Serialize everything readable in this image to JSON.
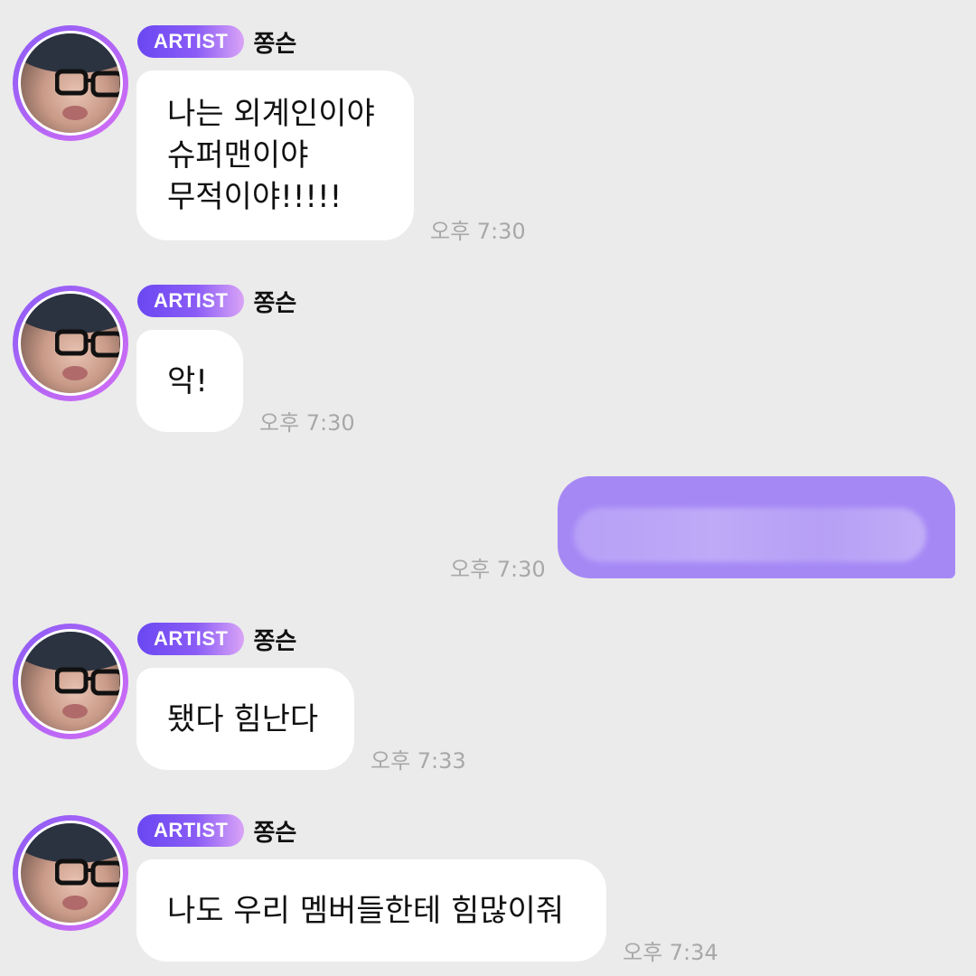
{
  "sender": {
    "badge": "ARTIST",
    "name": "쫑슨"
  },
  "messages": [
    {
      "lines": [
        "나는 외계인이야",
        "슈퍼맨이야",
        "무적이야!!!!!"
      ],
      "time": "오후 7:30"
    },
    {
      "lines": [
        "악!"
      ],
      "time": "오후 7:30"
    },
    {
      "outgoing": true,
      "content_hidden": true,
      "time": "오후 7:30"
    },
    {
      "lines": [
        "됐다 힘난다"
      ],
      "time": "오후 7:33"
    },
    {
      "lines": [
        "나도 우리 멤버들한테 힘많이줘"
      ],
      "time": "오후 7:34"
    }
  ],
  "colors": {
    "background": "#ebebeb",
    "incoming_bubble": "#ffffff",
    "outgoing_bubble": "#a688f5",
    "badge_start": "#6a47f2",
    "badge_end": "#d9a4f7",
    "avatar_ring": "#8a5cf6",
    "timestamp": "#a8a8a8"
  },
  "icons": {
    "avatar": "profile-photo"
  }
}
